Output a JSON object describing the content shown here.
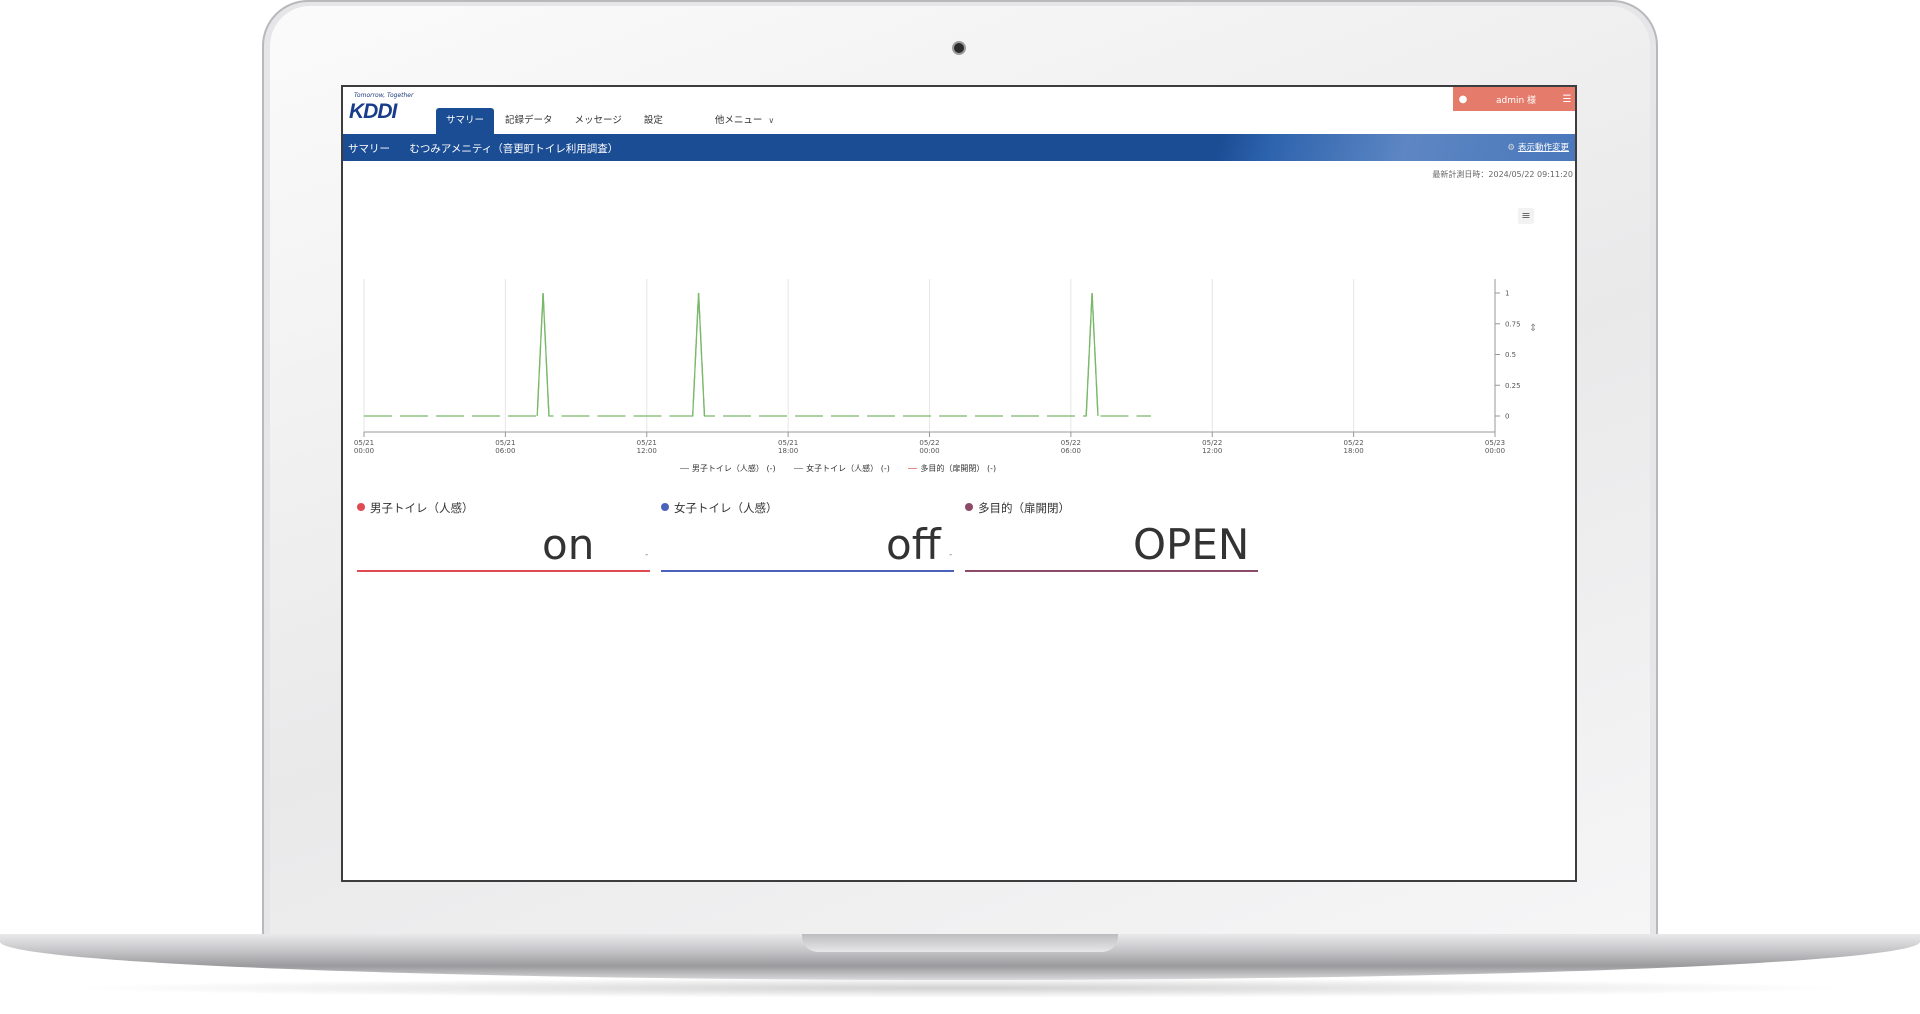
{
  "app": {
    "logo_tagline": "Tomorrow, Together",
    "logo_mark": "KDDI",
    "tabs": [
      {
        "label": "サマリー",
        "active": true
      },
      {
        "label": "記録データ",
        "active": false
      },
      {
        "label": "メッセージ",
        "active": false
      },
      {
        "label": "設定",
        "active": false
      },
      {
        "label": "他メニュー",
        "active": false,
        "dropdown": true
      }
    ],
    "user": {
      "name": "admin 様",
      "icon": "user-icon",
      "menu_icon": "list-icon"
    }
  },
  "breadcrumb": {
    "section": "サマリー",
    "title": "むつみアメニティ（音更町トイレ利用調査）",
    "setting_label": "表示動作変更",
    "setting_icon": "gear-icon"
  },
  "last_updated": "最新計測日時：2024/05/22 09:11:20",
  "chart_data": {
    "type": "line",
    "x_ticks": [
      {
        "date": "05/21",
        "time": "00:00"
      },
      {
        "date": "05/21",
        "time": "06:00"
      },
      {
        "date": "05/21",
        "time": "12:00"
      },
      {
        "date": "05/21",
        "time": "18:00"
      },
      {
        "date": "05/22",
        "time": "00:00"
      },
      {
        "date": "05/22",
        "time": "06:00"
      },
      {
        "date": "05/22",
        "time": "12:00"
      },
      {
        "date": "05/22",
        "time": "18:00"
      },
      {
        "date": "05/23",
        "time": "00:00"
      }
    ],
    "y_ticks": [
      "0",
      "0.25",
      "0.5",
      "0.75",
      "1"
    ],
    "ylim": [
      0,
      1
    ],
    "xlim_hours": [
      0,
      48
    ],
    "series": [
      {
        "name": "男子トイレ（人感）",
        "unit": "(-)",
        "color": "#e06666",
        "values": []
      },
      {
        "name": "女子トイレ（人感）",
        "unit": "(-)",
        "color": "#5b6fbf",
        "values": []
      },
      {
        "name": "多目的（扉開閉）",
        "unit": "(-)",
        "color": "#7ab86a",
        "spikes_hours": [
          7.6,
          14.2,
          30.9
        ],
        "end_hours": 33.4
      }
    ],
    "legend_position": "bottom-center",
    "grid": true
  },
  "cards": [
    {
      "title": "男子トイレ（人感）",
      "value": "on",
      "unit": "-",
      "color": "#e04a55"
    },
    {
      "title": "女子トイレ（人感）",
      "value": "off",
      "unit": "-",
      "color": "#4a63b8"
    },
    {
      "title": "多目的（扉開閉）",
      "value": "OPEN",
      "unit": "",
      "color": "#8c4a68"
    }
  ]
}
